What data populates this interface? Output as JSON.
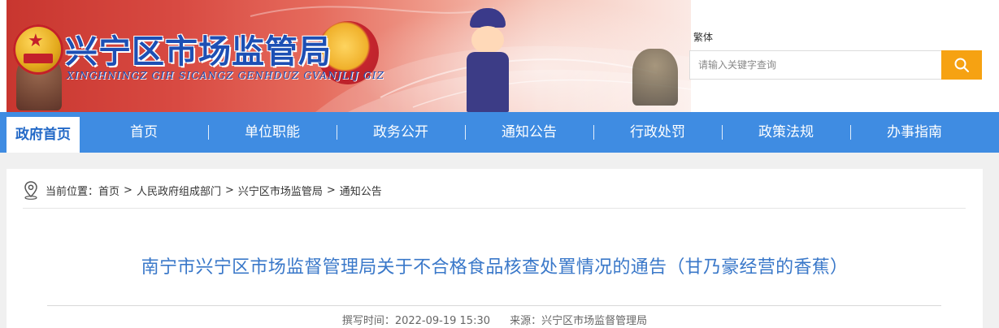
{
  "header": {
    "site_title": "兴宁区市场监管局",
    "site_pinyin": "XINGHNINGZ GIH SICANGZ GENHDUZ GVANJLIJ GIZ",
    "lang_toggle": "繁体",
    "search": {
      "placeholder": "请输入关键字查询",
      "button_icon": "search-icon"
    }
  },
  "nav": {
    "home_tab": "政府首页",
    "items": [
      "首页",
      "单位职能",
      "政务公开",
      "通知公告",
      "行政处罚",
      "政策法规",
      "办事指南"
    ]
  },
  "breadcrumb": {
    "label": "当前位置：",
    "items": [
      "首页",
      "人民政府组成部门",
      "兴宁区市场监管局",
      "通知公告"
    ],
    "separator": ">"
  },
  "article": {
    "title": "南宁市兴宁区市场监督管理局关于不合格食品核查处置情况的通告（甘乃豪经营的香蕉）",
    "meta": {
      "time_label": "撰写时间：",
      "time": "2022-09-19 15:30",
      "source_label": "来源：",
      "source": "兴宁区市场监督管理局"
    }
  },
  "colors": {
    "nav_blue": "#3f8ce2",
    "search_orange": "#f6a212",
    "title_blue": "#3a78c9",
    "site_title_blue": "#1d4fb4"
  }
}
